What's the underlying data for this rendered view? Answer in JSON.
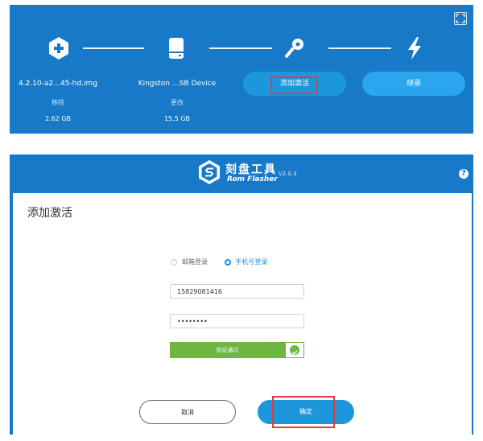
{
  "steps": {
    "image": {
      "name": "4.2.10-a2…45-hd.img",
      "action": "移除",
      "size": "2.62 GB"
    },
    "device": {
      "name": "Kingston …SB Device",
      "action": "更改",
      "size": "15.5 GB"
    },
    "activate_label": "添加激活",
    "flash_label": "烧录"
  },
  "app": {
    "title": "刻盘工具",
    "subtitle": "Rom Flasher",
    "version": "V2.0.3",
    "help": "?"
  },
  "dialog": {
    "title": "添加激活",
    "login_options": [
      "邮箱登录",
      "手机号登录"
    ],
    "phone_value": "15829081416",
    "password_value": "••••••••",
    "verify_label": "验证通过",
    "cancel_label": "取消",
    "confirm_label": "确定"
  },
  "colors": {
    "brand_blue": "#1779c7",
    "button_blue": "#1c97dc",
    "success_green": "#6eb642",
    "highlight_red": "#e23c3c"
  },
  "icons": [
    "plus-icon",
    "drive-icon",
    "key-icon",
    "lightning-icon",
    "expand-icon",
    "help-icon",
    "app-logo-icon",
    "check-icon"
  ]
}
